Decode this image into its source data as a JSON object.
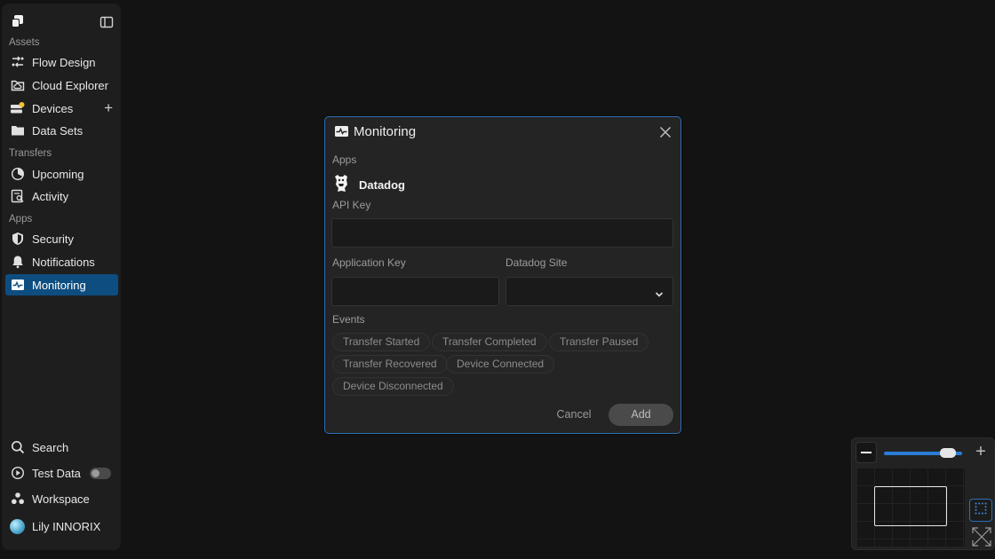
{
  "sidebar": {
    "sections": {
      "assets": "Assets",
      "transfers": "Transfers",
      "apps": "Apps"
    },
    "items": {
      "flow_design": "Flow Design",
      "cloud_explorer": "Cloud Explorer",
      "devices": "Devices",
      "data_sets": "Data Sets",
      "upcoming": "Upcoming",
      "activity": "Activity",
      "security": "Security",
      "notifications": "Notifications",
      "monitoring": "Monitoring"
    },
    "bottom": {
      "search": "Search",
      "test_data": "Test Data",
      "test_data_enabled": false,
      "workspace": "Workspace",
      "user": "Lily INNORIX"
    },
    "active_item": "monitoring",
    "devices_badge_color": "#f2c230"
  },
  "modal": {
    "title": "Monitoring",
    "apps_label": "Apps",
    "app_name": "Datadog",
    "api_key_label": "API Key",
    "api_key_value": "",
    "application_key_label": "Application Key",
    "application_key_value": "",
    "datadog_site_label": "Datadog Site",
    "datadog_site_value": "",
    "events_label": "Events",
    "events": [
      "Transfer Started",
      "Transfer Completed",
      "Transfer Paused",
      "Transfer Recovered",
      "Device Connected",
      "Device Disconnected"
    ],
    "cancel_label": "Cancel",
    "add_label": "Add"
  },
  "minimap": {
    "zoom_level": 0.9
  },
  "colors": {
    "accent": "#2a7cd6",
    "active_nav": "#0e4d80",
    "modal_border": "#2f6fb5"
  }
}
